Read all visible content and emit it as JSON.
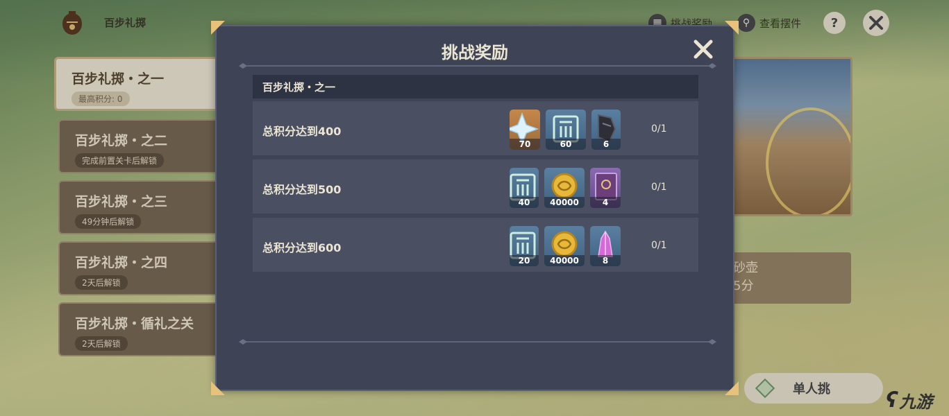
{
  "header": {
    "event_title": "百步礼掷",
    "challenge_rewards_label": "挑战奖励",
    "view_ornaments_label": "查看摆件",
    "help_label": "?"
  },
  "stages": [
    {
      "name": "百步礼掷・之一",
      "sub": "最高积分: 0"
    },
    {
      "name": "百步礼掷・之二",
      "sub": "完成前置关卡后解锁"
    },
    {
      "name": "百步礼掷・之三",
      "sub": "49分钟后解锁"
    },
    {
      "name": "百步礼掷・之四",
      "sub": "2天后解锁"
    },
    {
      "name": "百步礼掷・循礼之关",
      "sub": "2天后解锁"
    }
  ],
  "side_card": {
    "line1": "砂壶",
    "line2": "5分"
  },
  "single_button_label": "单人挑",
  "watermark": "九游",
  "modal": {
    "title": "挑战奖励",
    "section_title": "百步礼掷・之一",
    "rows": [
      {
        "label": "总积分达到400",
        "progress": "0/1",
        "items": [
          {
            "icon": "primogem-icon",
            "qty": "70"
          },
          {
            "icon": "hero-wit-icon",
            "qty": "60"
          },
          {
            "icon": "enhancement-ore-icon",
            "qty": "6"
          }
        ]
      },
      {
        "label": "总积分达到500",
        "progress": "0/1",
        "items": [
          {
            "icon": "hero-wit-icon",
            "qty": "40"
          },
          {
            "icon": "mora-icon",
            "qty": "40000"
          },
          {
            "icon": "talent-book-icon",
            "qty": "4"
          }
        ]
      },
      {
        "label": "总积分达到600",
        "progress": "0/1",
        "items": [
          {
            "icon": "hero-wit-icon",
            "qty": "20"
          },
          {
            "icon": "mora-icon",
            "qty": "40000"
          },
          {
            "icon": "crystal-icon",
            "qty": "8"
          }
        ]
      }
    ]
  },
  "colors": {
    "modal_bg": "#3e4456",
    "row_bg": "#4a5062",
    "text_light": "#ece5d3",
    "accent_gold": "#e8c27a"
  }
}
